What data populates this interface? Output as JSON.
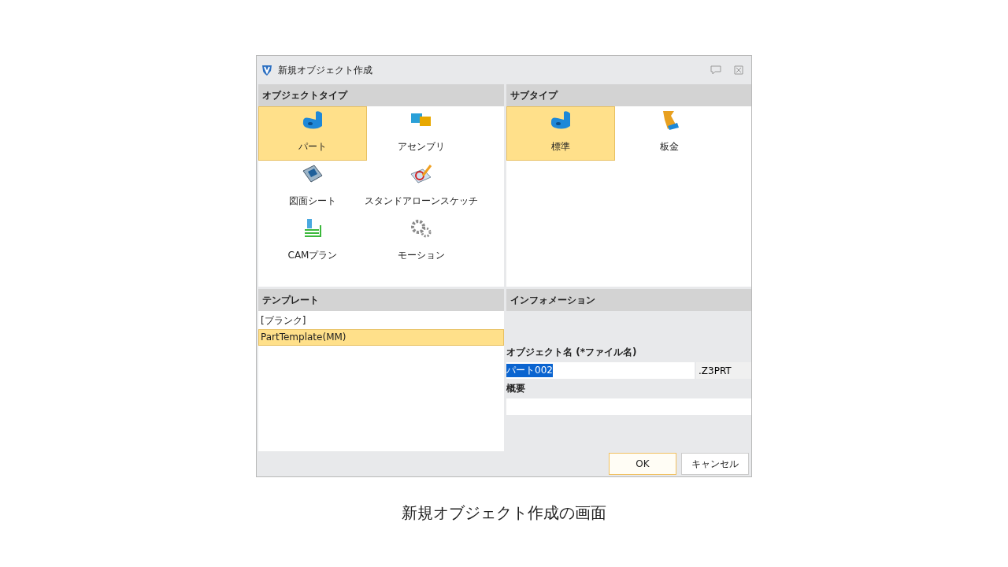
{
  "window": {
    "title": "新規オブジェクト作成"
  },
  "object_type": {
    "header": "オブジェクトタイプ",
    "items": [
      {
        "label": "パート",
        "kind": "part",
        "selected": true
      },
      {
        "label": "アセンブリ",
        "kind": "assembly",
        "selected": false
      },
      {
        "label": "図面シート",
        "kind": "drawing",
        "selected": false
      },
      {
        "label": "スタンドアローンスケッチ",
        "kind": "sketch",
        "selected": false
      },
      {
        "label": "CAMプラン",
        "kind": "cam",
        "selected": false
      },
      {
        "label": "モーション",
        "kind": "motion",
        "selected": false
      }
    ]
  },
  "subtype": {
    "header": "サブタイプ",
    "items": [
      {
        "label": "標準",
        "kind": "part",
        "selected": true
      },
      {
        "label": "板金",
        "kind": "sheetmetal",
        "selected": false
      }
    ]
  },
  "template": {
    "header": "テンプレート",
    "items": [
      {
        "label": "[ブランク]",
        "selected": false
      },
      {
        "label": "PartTemplate(MM)",
        "selected": true
      }
    ]
  },
  "information": {
    "header": "インフォメーション",
    "name_label": "オブジェクト名 (*ファイル名)",
    "name_value": "パート002",
    "name_value_selected": true,
    "extension": ".Z3PRT",
    "summary_label": "概要"
  },
  "buttons": [
    {
      "label": "OK",
      "default": true
    },
    {
      "label": "キャンセル",
      "default": false
    }
  ],
  "caption": "新規オブジェクト作成の画面"
}
